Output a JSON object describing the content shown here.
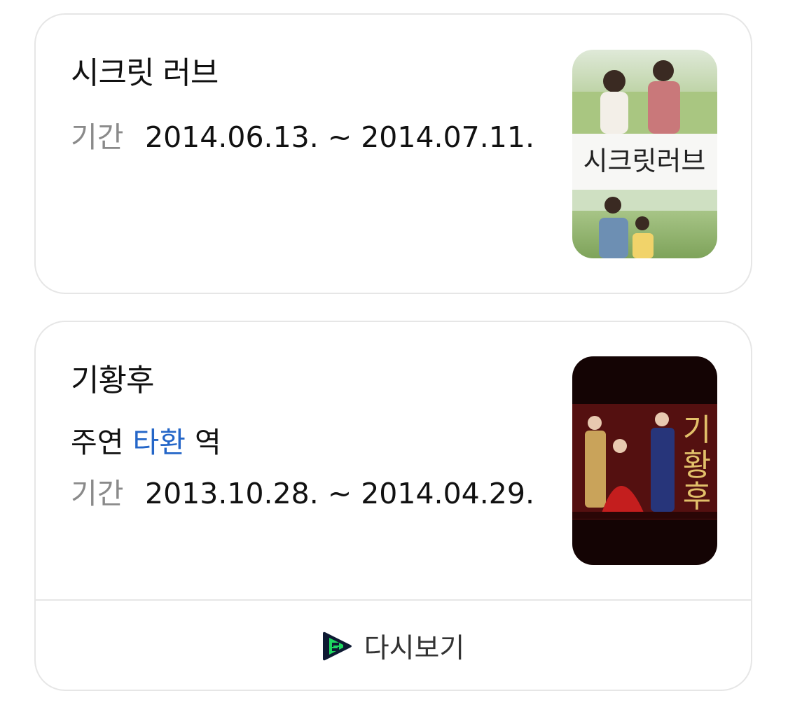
{
  "cards": [
    {
      "title": "시크릿 러브",
      "period_label": "기간",
      "period_value": "2014.06.13. ~ 2014.07.11.",
      "poster_text": "시크릿러브"
    },
    {
      "title": "기황후",
      "role_prefix": "주연",
      "role_name": "타환",
      "role_suffix": "역",
      "period_label": "기간",
      "period_value": "2013.10.28. ~ 2014.04.29.",
      "poster_text": "기황후",
      "replay_label": "다시보기",
      "replay_icon": "replay-play-icon"
    }
  ],
  "colors": {
    "link": "#2466c8",
    "label": "#8a8a8a",
    "border": "#e6e6e6",
    "replay_icon_green": "#1ed760"
  }
}
